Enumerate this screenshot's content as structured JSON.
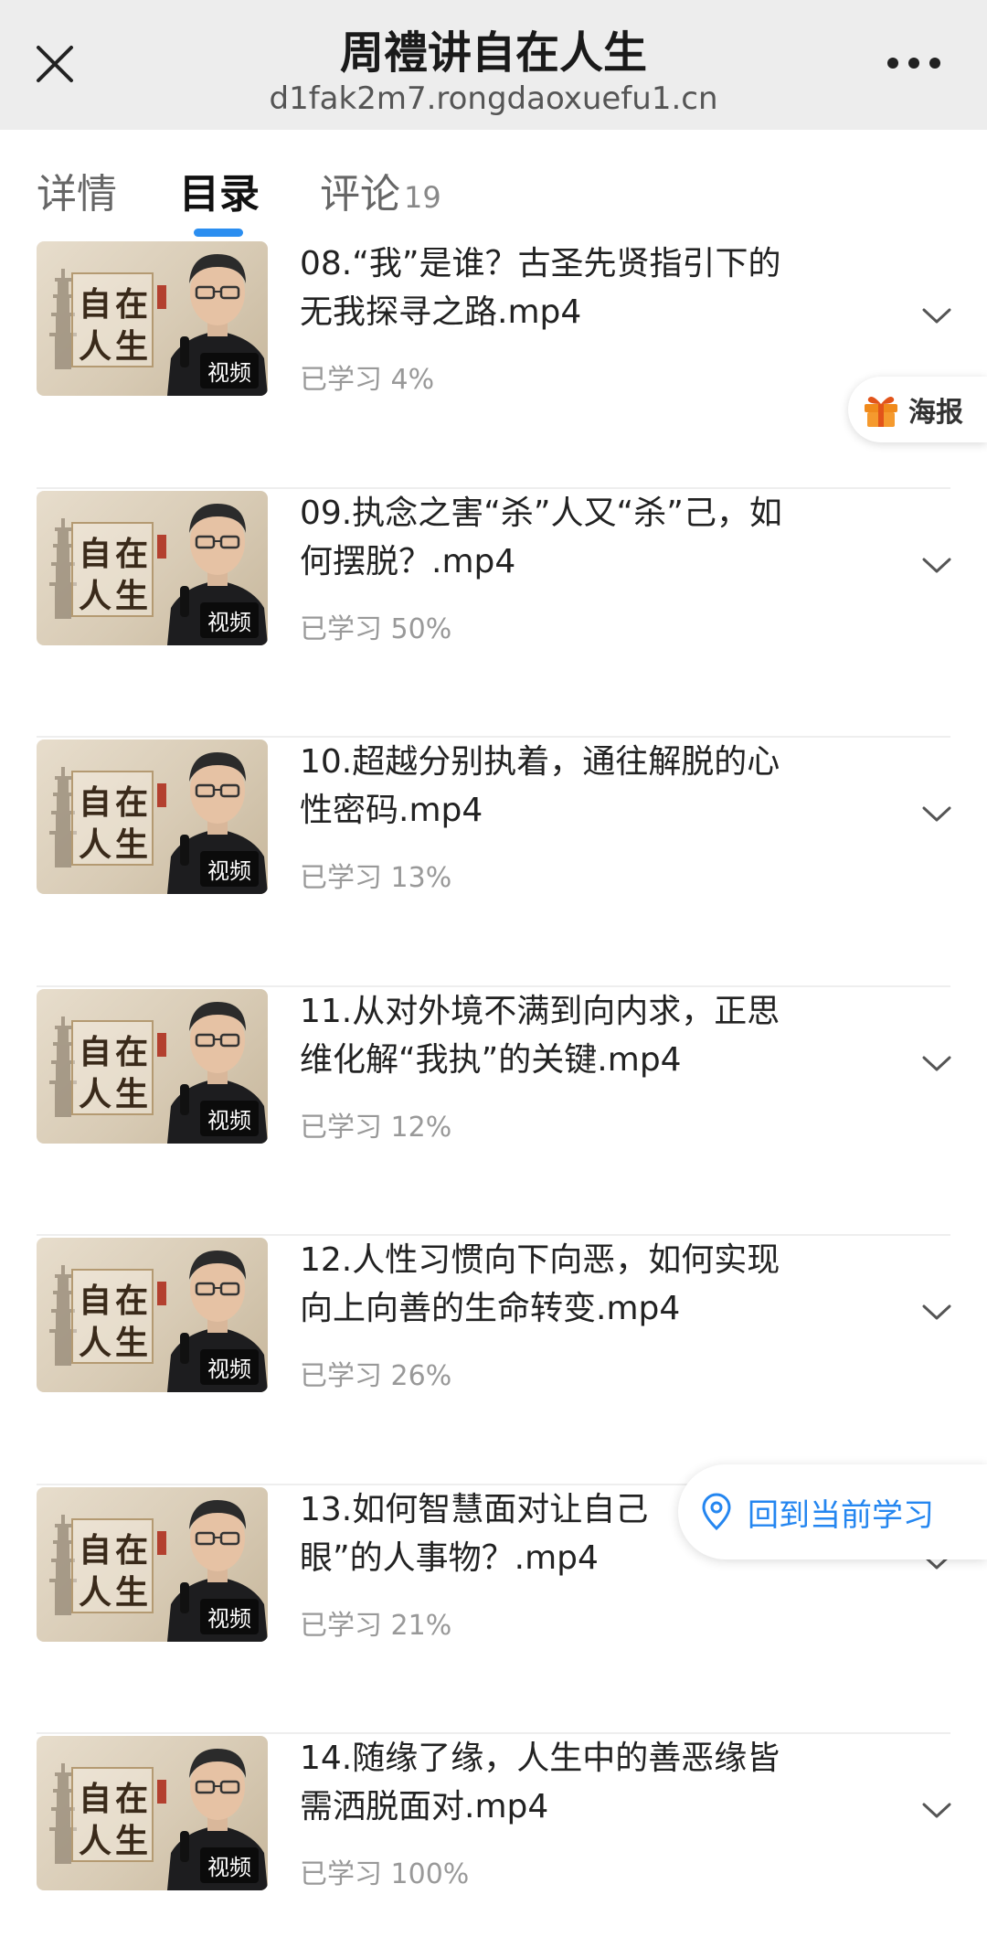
{
  "header": {
    "title": "周禮讲自在人生",
    "url": "d1fak2m7.rongdaoxuefu1.cn"
  },
  "tabs": [
    {
      "label": "详情",
      "count": ""
    },
    {
      "label": "目录",
      "count": ""
    },
    {
      "label": "评论",
      "count": "19"
    }
  ],
  "thumbnail": {
    "title_chars": [
      "自",
      "在",
      "人",
      "生"
    ],
    "badge": "视频"
  },
  "items": [
    {
      "title": "08.“我”是谁？古圣先贤指引下的无我探寻之路.mp4",
      "progress": "已学习 4%"
    },
    {
      "title": "09.执念之害“杀”人又“杀”己，如何摆脱？.mp4",
      "progress": "已学习 50%"
    },
    {
      "title": "10.超越分别执着，通往解脱的心性密码.mp4",
      "progress": "已学习 13%"
    },
    {
      "title": "11.从对外境不满到向内求，正思维化解“我执”的关键.mp4",
      "progress": "已学习 12%"
    },
    {
      "title": "12.人性习惯向下向恶，如何实现向上向善的生命转变.mp4",
      "progress": "已学习 26%"
    },
    {
      "title": "13.如何智慧面对让自己",
      "title_line2": "眼”的人事物？.mp4",
      "progress": "已学习 21%"
    },
    {
      "title": "14.随缘了缘，人生中的善恶缘皆需洒脱面对.mp4",
      "progress": "已学习 100%"
    }
  ],
  "floating": {
    "poster_label": "海报",
    "return_label": "回到当前学习"
  },
  "colors": {
    "accent": "#2486f0",
    "indicator": "#2b8ef0",
    "topbar_bg": "#ededed",
    "progress_text": "#999999",
    "gift": "#f08a1c"
  },
  "icons": {
    "close": "close-icon",
    "more": "more-dots-icon",
    "chevron": "chevron-down-icon",
    "gift": "gift-icon",
    "location": "location-pin-icon"
  }
}
